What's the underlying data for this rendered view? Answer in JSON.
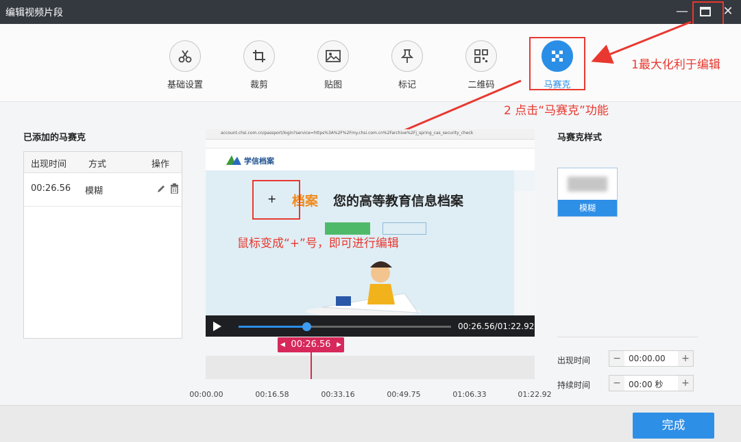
{
  "window": {
    "title": "编辑视频片段",
    "minimize": "—",
    "maximize": "▣",
    "close": "✕"
  },
  "tabs": [
    {
      "label": "基础设置",
      "icon": "scissors-icon"
    },
    {
      "label": "裁剪",
      "icon": "crop-icon"
    },
    {
      "label": "贴图",
      "icon": "image-icon"
    },
    {
      "label": "标记",
      "icon": "pin-icon"
    },
    {
      "label": "二维码",
      "icon": "qrcode-icon"
    },
    {
      "label": "马赛克",
      "icon": "mosaic-icon",
      "active": true
    }
  ],
  "annotations": {
    "maximize_hint": "1最大化利于编辑",
    "mosaic_hint": "2 点击“马赛克”功能",
    "cursor_hint": "鼠标变成“+”号，即可进行编辑",
    "cursor_symbol": "+"
  },
  "left_panel": {
    "title": "已添加的马赛克",
    "columns": [
      "出现时间",
      "方式",
      "操作"
    ],
    "rows": [
      {
        "time": "00:26.56",
        "mode": "模糊"
      }
    ]
  },
  "video": {
    "url": "account.chsi.com.cn/passport/login?service=https%3A%2F%2Fmy.chsi.com.cn%2Farchive%2Fj_spring_cas_security_check",
    "site_name": "学信档案",
    "banner_highlight": "档案",
    "banner_text": "您的高等教育信息档案",
    "current_time": "00:26.56",
    "duration": "01:22.92",
    "time_display": "00:26.56/01:22.92",
    "progress_fraction": 0.32
  },
  "timeline": {
    "marker_time": "00:26.56",
    "ticks": [
      "00:00.00",
      "00:16.58",
      "00:33.16",
      "00:49.75",
      "01:06.33",
      "01:22.92"
    ]
  },
  "right_panel": {
    "title": "马赛克样式",
    "style_option": "模糊",
    "appear_label": "出现时间",
    "appear_value": "00:00.00",
    "duration_label": "持续时间",
    "duration_value": "00:00 秒"
  },
  "footer": {
    "done_label": "完成"
  },
  "colors": {
    "accent": "#2a8ee7",
    "annotation": "#e8382f",
    "timeline_marker": "#d6285a"
  }
}
